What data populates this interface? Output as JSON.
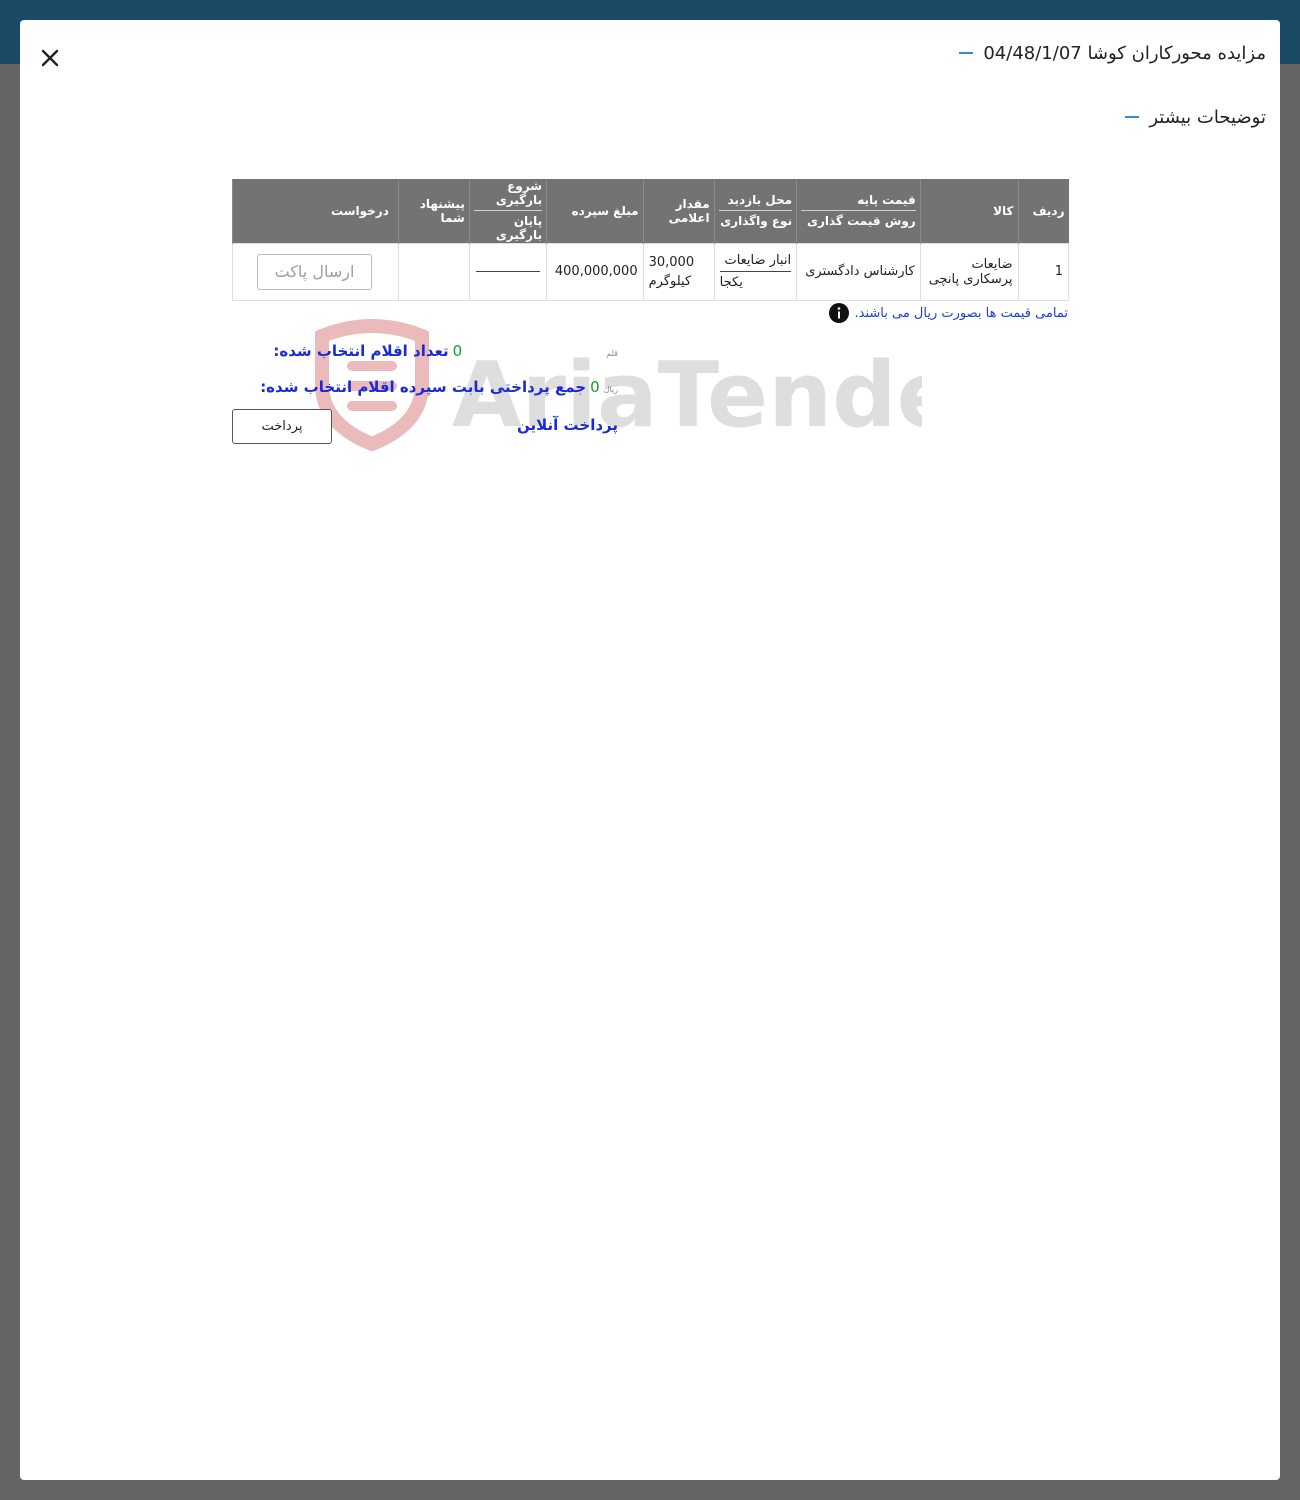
{
  "modal": {
    "title": "مزایده محورکاران کوشا 04/48/1/07",
    "section_title": "توضیحات بیشتر"
  },
  "table": {
    "headers": {
      "row_no": "ردیف",
      "item": "کالا",
      "base_price": "قیمت پایه",
      "pricing_method": "روش قیمت گذاری",
      "visit_place": "محل بازدید",
      "assignment_type": "نوع واگذاری",
      "quantity": "مقدار اعلامی",
      "deposit": "مبلغ سپرده",
      "loading_start": "شروع بارگیری",
      "loading_end": "پایان بارگیری",
      "your_offer": "پیشنهاد شما",
      "request": "درخواست"
    },
    "rows": [
      {
        "row_no": "1",
        "item": "ضایعات پرسکاری پانچی",
        "pricing": "کارشناس دادگستری",
        "visit_place": "انبار ضایعات",
        "assignment_type": "یکجا",
        "quantity": "30,000",
        "unit": "کیلوگرم",
        "deposit": "400,000,000",
        "send_button": "ارسال پاکت"
      }
    ]
  },
  "note": "تمامی قیمت ها بصورت ریال می باشند.",
  "watermark_text": "AriaTender.neT",
  "summary": {
    "selected_count_label": "تعداد اقلام انتخاب شده:",
    "selected_count_value": "0",
    "selected_count_unit": "قلم",
    "deposit_total_label": "جمع پرداختی بابت سپرده اقلام انتخاب شده:",
    "deposit_total_value": "0",
    "deposit_total_unit": "ریال",
    "online_payment_label": "پرداخت آنلاین",
    "pay_button": "پرداخت"
  },
  "colors": {
    "topbar": "#1a4a66",
    "backdrop": "#646464",
    "table_header": "#737373",
    "accent_dash": "#2d8fd8",
    "summary_label": "#1a2bd6",
    "summary_value": "#139a2b",
    "watermark_red": "#d94a4a",
    "watermark_gray": "#bdbdbd"
  },
  "icons": {
    "close": "close-icon",
    "info": "info-icon"
  }
}
